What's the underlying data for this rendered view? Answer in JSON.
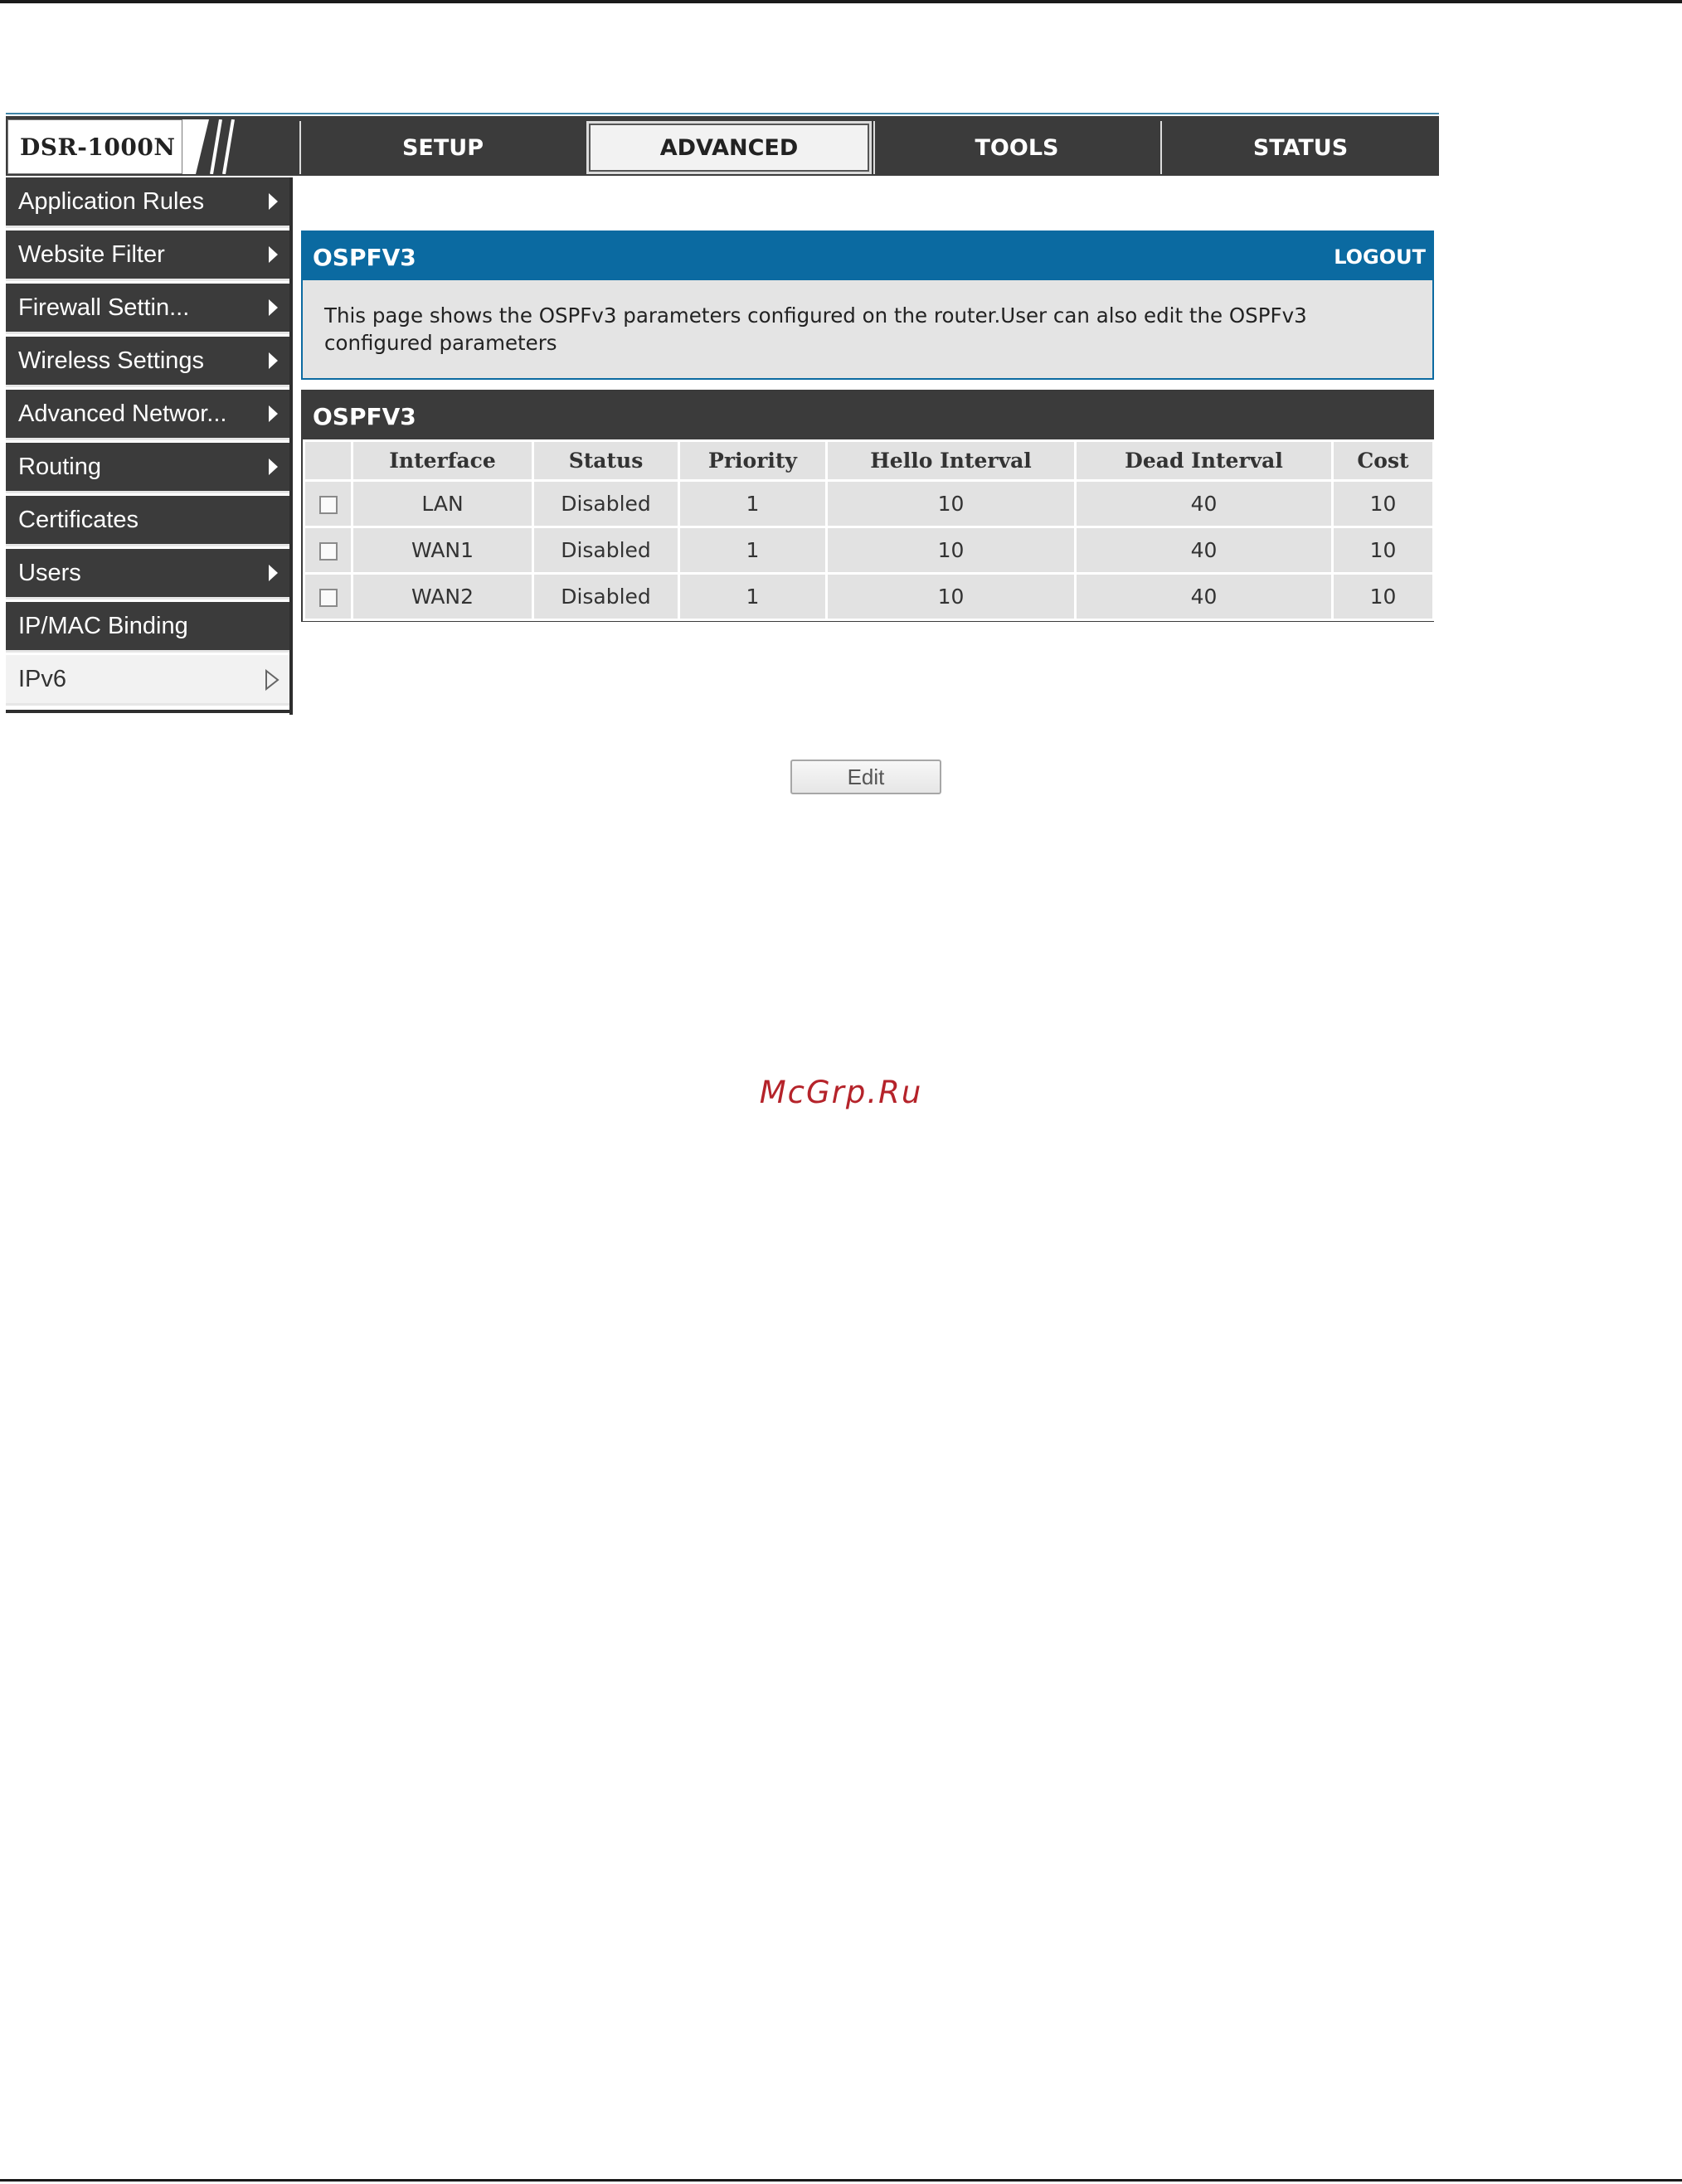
{
  "header": {
    "brand": "DSR-1000N",
    "tabs": [
      {
        "label": "SETUP"
      },
      {
        "label": "ADVANCED"
      },
      {
        "label": "TOOLS"
      },
      {
        "label": "STATUS"
      }
    ]
  },
  "sidebar": {
    "items": [
      {
        "label": "Application Rules"
      },
      {
        "label": "Website Filter"
      },
      {
        "label": "Firewall Settin..."
      },
      {
        "label": "Wireless Settings"
      },
      {
        "label": "Advanced Networ..."
      },
      {
        "label": "Routing"
      },
      {
        "label": "Certificates"
      },
      {
        "label": "Users"
      },
      {
        "label": "IP/MAC Binding"
      },
      {
        "label": "IPv6"
      }
    ]
  },
  "info_panel": {
    "title": "OSPFV3",
    "logout": "LOGOUT",
    "description": "This page shows the OSPFv3 parameters configured on the router.User can also edit the OSPFv3 configured parameters"
  },
  "table_panel": {
    "title": "OSPFV3",
    "columns": [
      "Interface",
      "Status",
      "Priority",
      "Hello Interval",
      "Dead Interval",
      "Cost"
    ],
    "rows": [
      {
        "interface": "LAN",
        "status": "Disabled",
        "priority": "1",
        "hello": "10",
        "dead": "40",
        "cost": "10"
      },
      {
        "interface": "WAN1",
        "status": "Disabled",
        "priority": "1",
        "hello": "10",
        "dead": "40",
        "cost": "10"
      },
      {
        "interface": "WAN2",
        "status": "Disabled",
        "priority": "1",
        "hello": "10",
        "dead": "40",
        "cost": "10"
      }
    ]
  },
  "edit_button": "Edit",
  "watermark": "McGrp.Ru"
}
